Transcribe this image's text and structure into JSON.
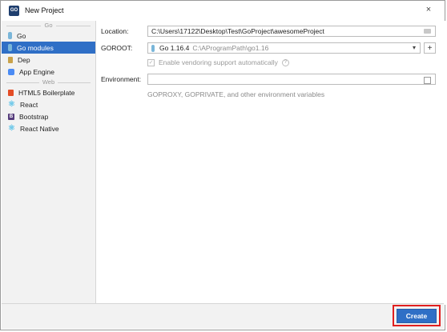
{
  "window": {
    "title": "New Project",
    "app_icon_text": "GO",
    "close_label": "×"
  },
  "sidebar": {
    "sections": [
      {
        "header": "Go",
        "items": [
          {
            "label": "Go",
            "icon": "go-icon",
            "selected": false
          },
          {
            "label": "Go modules",
            "icon": "go-modules-icon",
            "selected": true
          },
          {
            "label": "Dep",
            "icon": "dep-icon",
            "selected": false
          },
          {
            "label": "App Engine",
            "icon": "app-engine-icon",
            "selected": false
          }
        ]
      },
      {
        "header": "Web",
        "items": [
          {
            "label": "HTML5 Boilerplate",
            "icon": "html5-icon",
            "selected": false
          },
          {
            "label": "React",
            "icon": "react-icon",
            "selected": false
          },
          {
            "label": "Bootstrap",
            "icon": "bootstrap-icon",
            "selected": false
          },
          {
            "label": "React Native",
            "icon": "react-native-icon",
            "selected": false
          }
        ]
      }
    ]
  },
  "form": {
    "location_label": "Location:",
    "location_value": "C:\\Users\\17122\\Desktop\\Test\\GoProject\\awesomeProject",
    "goroot_label": "GOROOT:",
    "goroot_sdk_name": "Go 1.16.4",
    "goroot_sdk_path": "C:\\AProgramPath\\go1.16",
    "add_label": "+",
    "vendoring_label": "Enable vendoring support automatically",
    "vendoring_checked": true,
    "help_glyph": "?",
    "environment_label": "Environment:",
    "environment_value": "",
    "environment_hint": "GOPROXY, GOPRIVATE, and other environment variables"
  },
  "footer": {
    "create_label": "Create"
  },
  "colors": {
    "accent": "#2f6fc6",
    "highlight_border": "#e02020"
  }
}
